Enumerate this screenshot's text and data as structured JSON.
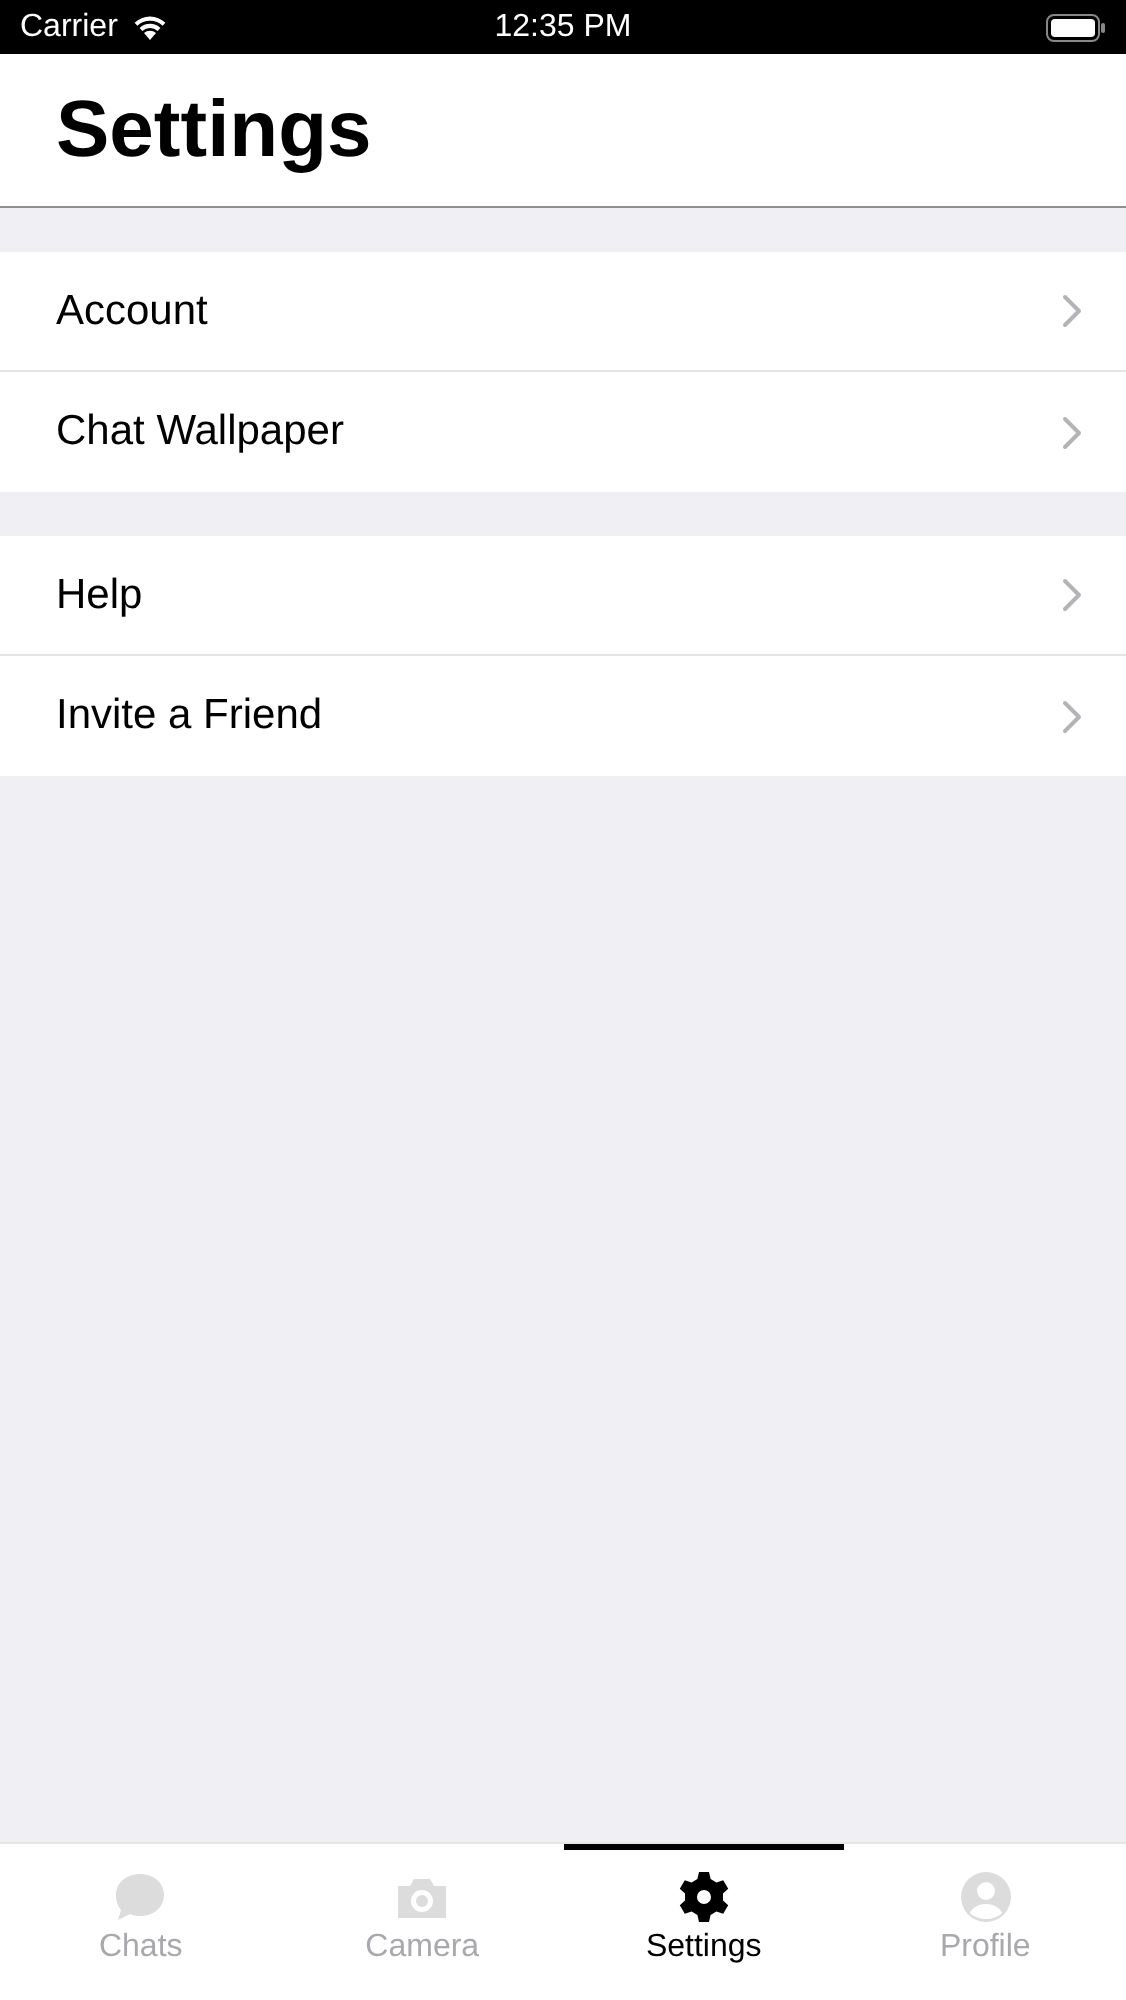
{
  "status_bar": {
    "carrier": "Carrier",
    "time": "12:35 PM"
  },
  "header": {
    "title": "Settings"
  },
  "groups": [
    {
      "items": [
        {
          "label": "Account"
        },
        {
          "label": "Chat Wallpaper"
        }
      ]
    },
    {
      "items": [
        {
          "label": "Help"
        },
        {
          "label": "Invite a Friend"
        }
      ]
    }
  ],
  "tab_bar": {
    "tabs": [
      {
        "kind": "chats",
        "label": "Chats",
        "selected": false
      },
      {
        "kind": "camera",
        "label": "Camera",
        "selected": false
      },
      {
        "kind": "settings",
        "label": "Settings",
        "selected": true
      },
      {
        "kind": "profile",
        "label": "Profile",
        "selected": false
      }
    ]
  }
}
